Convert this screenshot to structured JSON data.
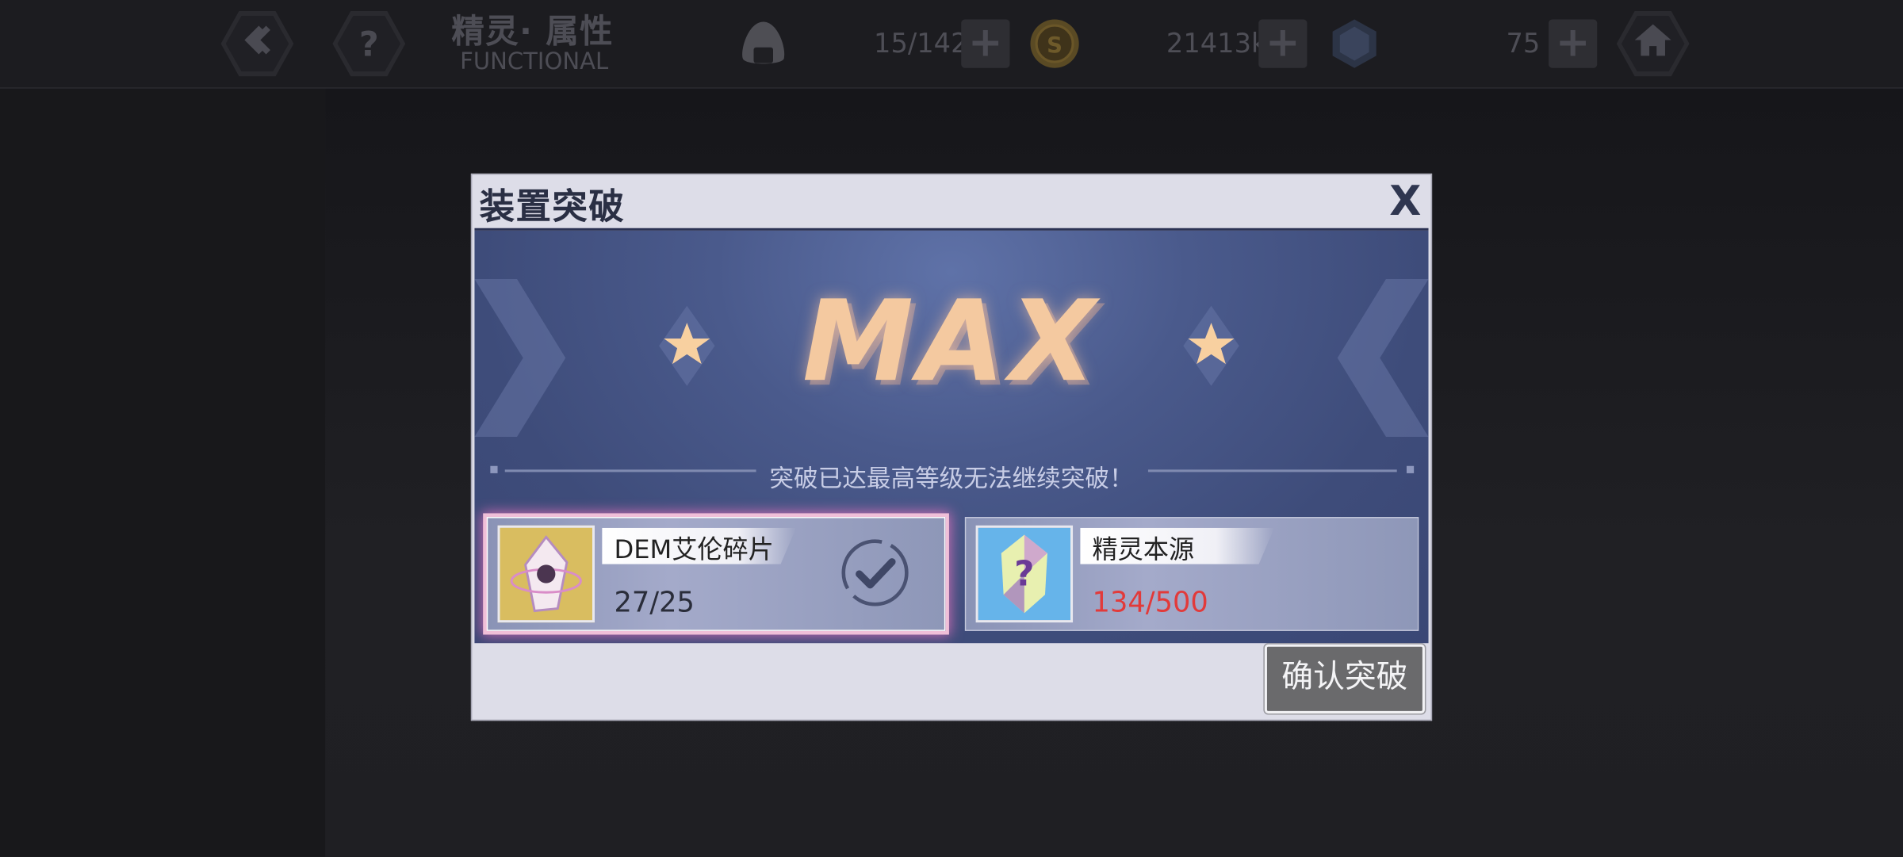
{
  "header": {
    "title_cn": "精灵· 属性",
    "title_en": "FUNCTIONAL",
    "stamina": "15/142",
    "coins": "21413k",
    "crystals": "75"
  },
  "dialog": {
    "title": "装置突破",
    "close_label": "X",
    "max_label": "MAX",
    "message": "突破已达最高等级无法继续突破！",
    "materials": [
      {
        "name": "DEM艾伦碎片",
        "count": "27/25",
        "sufficient": true
      },
      {
        "name": "精灵本源",
        "count": "134/500",
        "sufficient": false
      }
    ],
    "confirm_label": "确认突破"
  },
  "colors": {
    "insufficient": "#e23a3a",
    "max_text": "#f4c9a0",
    "panel": "#4a5a8c"
  }
}
